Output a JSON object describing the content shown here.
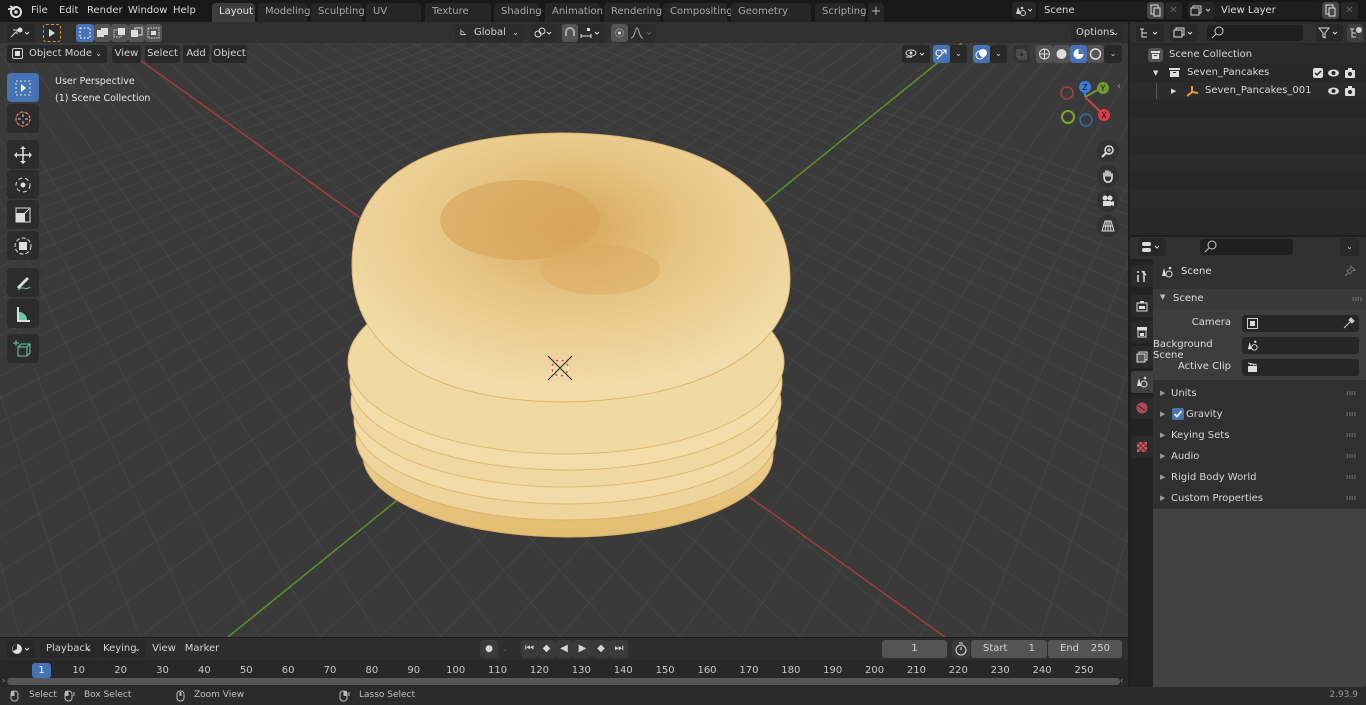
{
  "top_menu": {
    "items": [
      "File",
      "Edit",
      "Render",
      "Window",
      "Help"
    ]
  },
  "workspace_tabs": [
    {
      "label": "Layout",
      "active": true
    },
    {
      "label": "Modeling"
    },
    {
      "label": "Sculpting"
    },
    {
      "label": "UV Editing"
    },
    {
      "label": "Texture Paint"
    },
    {
      "label": "Shading"
    },
    {
      "label": "Animation"
    },
    {
      "label": "Rendering"
    },
    {
      "label": "Compositing"
    },
    {
      "label": "Geometry Nodes"
    },
    {
      "label": "Scripting"
    }
  ],
  "add_workspace_label": "+",
  "scene_selector": {
    "value": "Scene"
  },
  "view_layer_selector": {
    "value": "View Layer"
  },
  "viewport_header": {
    "mode": "Object Mode",
    "menus": [
      "View",
      "Select",
      "Add",
      "Object"
    ],
    "transform_orientation": "Global",
    "options_label": "Options"
  },
  "viewport": {
    "overlay_line1": "User Perspective",
    "overlay_line2": "(1) Scene Collection",
    "gizmo": {
      "x_label": "X",
      "y_label": "Y",
      "z_label": "Z"
    },
    "colors": {
      "x_axis": "#c8454f",
      "y_axis": "#6e9a2f",
      "z_axis": "#3d7ed8",
      "selected": "#4772b3"
    }
  },
  "outliner": {
    "root": "Scene Collection",
    "items": [
      {
        "label": "Seven_Pancakes",
        "type": "collection",
        "checked": true
      },
      {
        "label": "Seven_Pancakes_001",
        "type": "object"
      }
    ]
  },
  "properties": {
    "context_label": "Scene",
    "section_title": "Scene",
    "fields": [
      {
        "label": "Camera",
        "value": ""
      },
      {
        "label": "Background Scene",
        "value": ""
      },
      {
        "label": "Active Clip",
        "value": ""
      }
    ],
    "panels": [
      {
        "label": "Units"
      },
      {
        "label": "Gravity",
        "checkbox": true
      },
      {
        "label": "Keying Sets"
      },
      {
        "label": "Audio"
      },
      {
        "label": "Rigid Body World"
      },
      {
        "label": "Custom Properties"
      }
    ]
  },
  "timeline": {
    "menus": [
      "Playback",
      "Keying",
      "View",
      "Marker"
    ],
    "current_frame": "1",
    "start_label": "Start",
    "start_value": "1",
    "end_label": "End",
    "end_value": "250",
    "ticks": [
      "1",
      "10",
      "20",
      "30",
      "40",
      "50",
      "60",
      "70",
      "80",
      "90",
      "100",
      "110",
      "120",
      "130",
      "140",
      "150",
      "160",
      "170",
      "180",
      "190",
      "200",
      "210",
      "220",
      "230",
      "240",
      "250"
    ]
  },
  "status_bar": {
    "hints": [
      "Select",
      "Box Select",
      "Zoom View",
      "Lasso Select"
    ],
    "version": "2.93.9"
  }
}
